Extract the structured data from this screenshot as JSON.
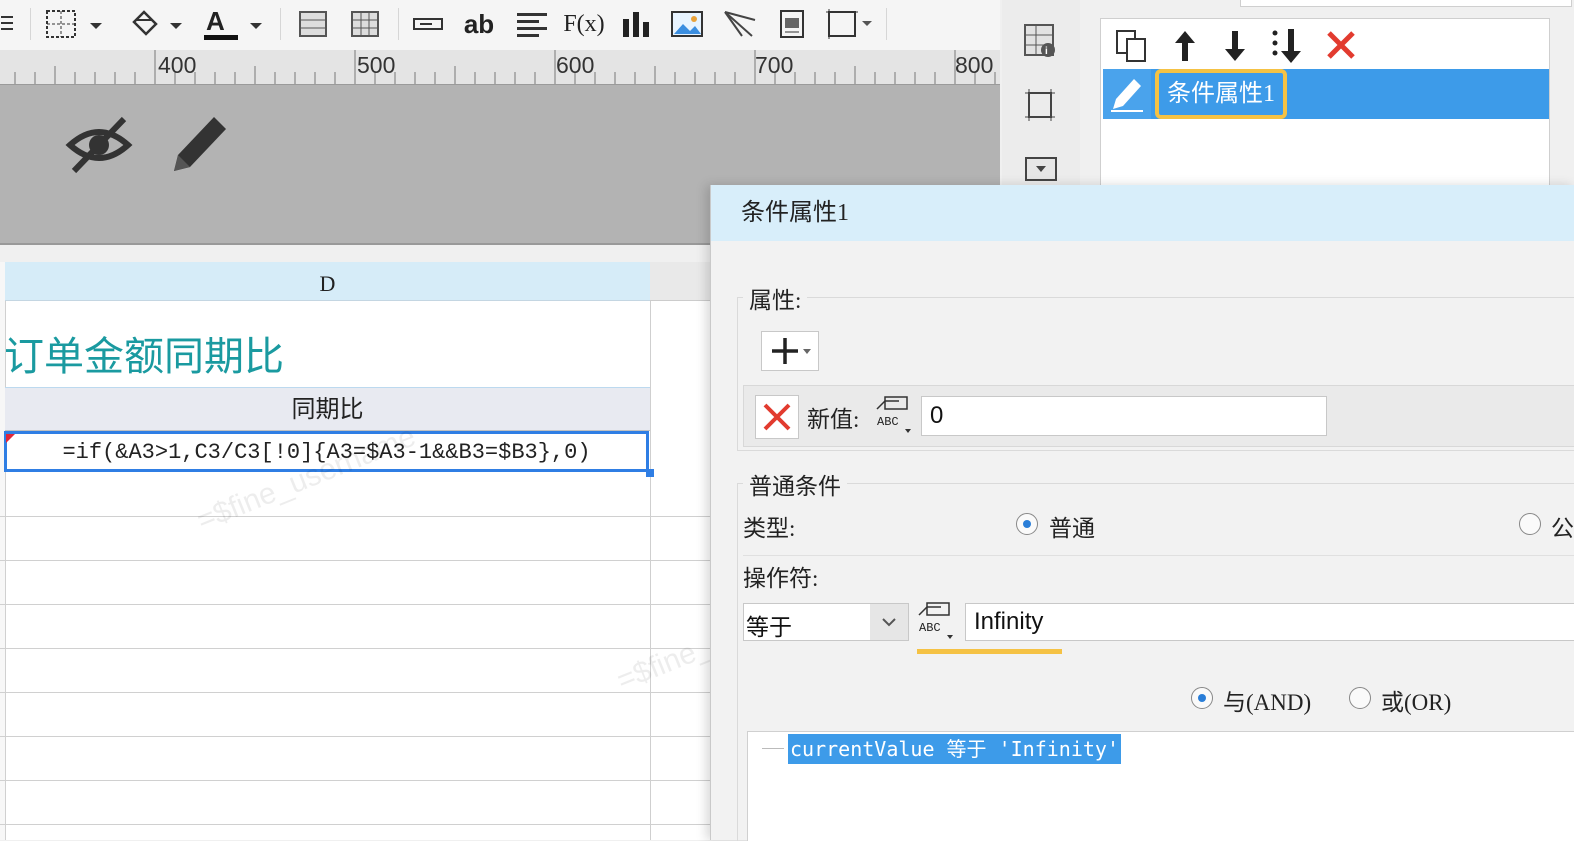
{
  "toolbar": {
    "icons": [
      "menu-icon",
      "borders-icon",
      "fill-color-icon",
      "font-color-icon",
      "merge-cells-icon",
      "table-icon",
      "text-field-icon",
      "text-ab-icon",
      "align-icon",
      "formula-icon",
      "bar-chart-icon",
      "image-icon",
      "slash-line-icon",
      "sub-report-icon",
      "frame-icon"
    ],
    "formula_label": "F(x)",
    "ab_label": "ab"
  },
  "ruler": {
    "labels": [
      "400",
      "500",
      "600",
      "700",
      "800"
    ]
  },
  "canvas": {
    "icons": [
      "hide-icon",
      "edit-pencil-icon"
    ]
  },
  "sheet": {
    "column_header": "D",
    "title": "订单金额同期比",
    "header_cell": "同期比",
    "formula_cell": "=if(&A3>1,C3/C3[!0]{A3=$A3-1&&B3=$B3},0)",
    "watermark": "=$fine_username"
  },
  "condition_list": {
    "toolbar_icons": [
      "copy-icon",
      "move-up-icon",
      "move-down-icon",
      "move-bottom-icon",
      "delete-icon"
    ],
    "items": [
      {
        "label": "条件属性1",
        "selected": true
      }
    ]
  },
  "dialog": {
    "title": "条件属性1",
    "attributes_label": "属性:",
    "new_value_label": "新值:",
    "new_value": "0",
    "normal_condition_label": "普通条件",
    "type_label": "类型:",
    "type_options": [
      "普通",
      "公"
    ],
    "operator_label": "操作符:",
    "operator_value": "等于",
    "operand_value": "Infinity",
    "and_label": "与(AND)",
    "or_label": "或(OR)",
    "condition_expression": "currentValue 等于 'Infinity'"
  },
  "colors": {
    "accent": "#3d9be9",
    "title_teal": "#1a9aa0",
    "highlight": "#f5c244",
    "delete_red": "#e23b2f"
  }
}
